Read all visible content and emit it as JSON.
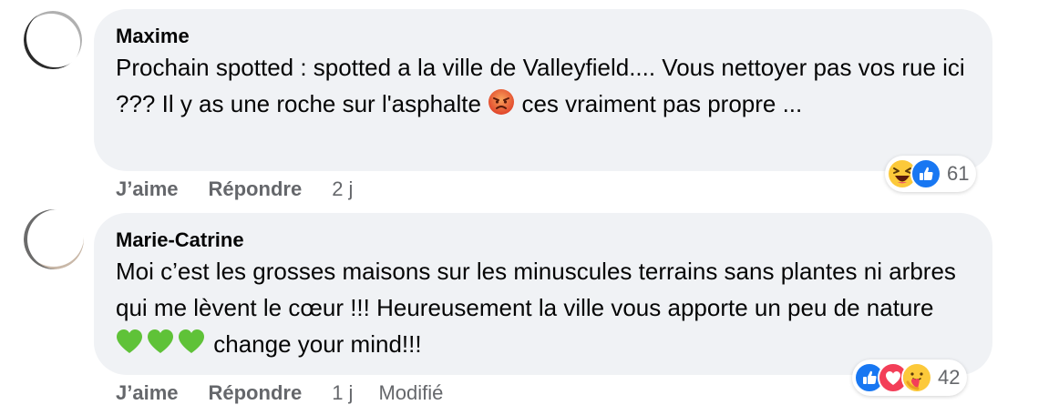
{
  "comments": [
    {
      "author": "Maxime",
      "text_parts": {
        "line_a": "Prochain spotted : spotted a la ville de Valleyfield.... Vous nettoyer pas vos rue ici ??? Il y as une roche sur l'asphalte",
        "line_b": "ces vraiment pas propre ..."
      },
      "inline_emoji": "angry-face-icon",
      "actions": {
        "like": "J’aime",
        "reply": "Répondre",
        "time": "2 j"
      },
      "reactions": {
        "icons": [
          "laughing-face-icon",
          "like-thumb-icon"
        ],
        "count": "61"
      }
    },
    {
      "author": "Marie-Catrine",
      "text_parts": {
        "line_a": "Moi c’est les grosses maisons sur les minuscules terrains sans plantes ni arbres qui me lèvent le cœur !!! Heureusement la ville vous apporte un peu de nature",
        "line_b": "change your mind!!!"
      },
      "inline_emoji": "green-heart-icon",
      "actions": {
        "like": "J’aime",
        "reply": "Répondre",
        "time": "1 j",
        "edited": "Modifié"
      },
      "reactions": {
        "icons": [
          "like-thumb-icon",
          "heart-icon",
          "care-face-icon"
        ],
        "count": "42"
      }
    }
  ],
  "colors": {
    "bubble": "#f0f2f5",
    "secondary_text": "#65676b",
    "like_blue": "#1877f2",
    "love_red": "#f33e58",
    "haha_yellow": "#fcd34d"
  }
}
